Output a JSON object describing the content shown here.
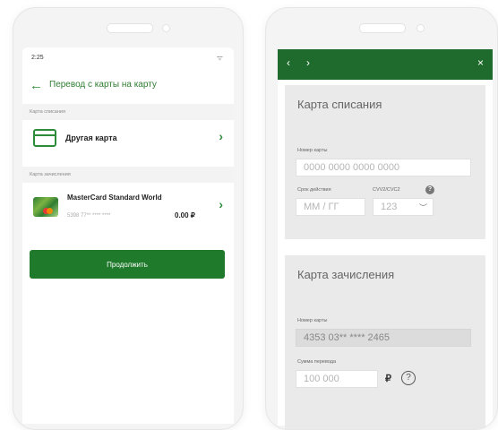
{
  "left": {
    "status_time": "2:25",
    "title": "Перевод с карты на карту",
    "section_from": "Карта списания",
    "other_card": "Другая карта",
    "section_to": "Карта зачисления",
    "card_name": "MasterCard Standard World",
    "card_masked": "5398 77** **** ****",
    "card_balance": "0.00 ₽",
    "continue": "Продолжить"
  },
  "right": {
    "nav_prev": "‹",
    "nav_next": "›",
    "close": "×",
    "from_panel": {
      "title": "Карта списания",
      "card_number_label": "Номер карты",
      "card_number_placeholder": "0000 0000 0000 0000",
      "expiry_label": "Срок действия",
      "expiry_placeholder": "ММ / ГГ",
      "cvv_label": "CVV2/CVC2",
      "cvv_placeholder": "123"
    },
    "to_panel": {
      "title": "Карта зачисления",
      "card_number_label": "Номер карты",
      "card_number_value": "4353 03** **** 2465",
      "amount_label": "Сумма перевода",
      "amount_placeholder": "100 000",
      "currency": "₽",
      "help": "?"
    }
  },
  "colors": {
    "brand_green": "#1f7a2c",
    "accent_green": "#2e8b3a"
  }
}
